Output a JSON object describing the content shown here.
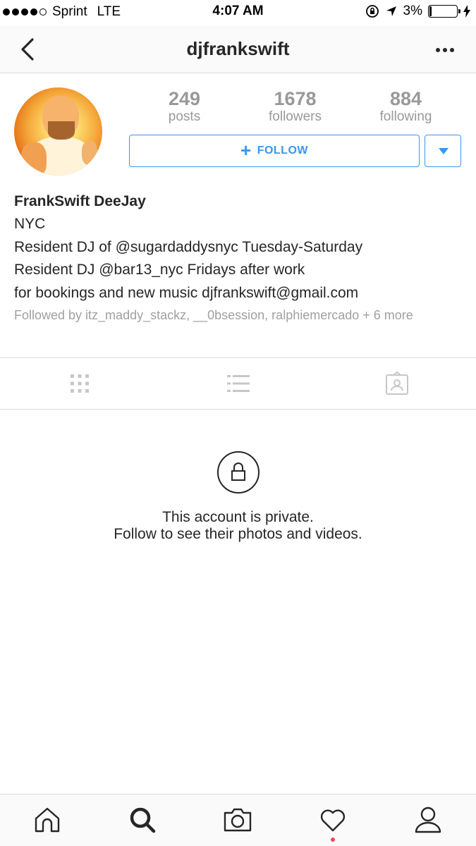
{
  "status_bar": {
    "carrier": "Sprint",
    "network": "LTE",
    "time": "4:07 AM",
    "battery": "3%",
    "signal_bars_filled": 4,
    "signal_bars_total": 5
  },
  "nav": {
    "title": "djfrankswift"
  },
  "stats": {
    "posts": {
      "value": "249",
      "label": "posts"
    },
    "followers": {
      "value": "1678",
      "label": "followers"
    },
    "following": {
      "value": "884",
      "label": "following"
    }
  },
  "actions": {
    "follow_label": "FOLLOW"
  },
  "bio": {
    "name": "FrankSwift DeeJay",
    "lines": [
      "NYC",
      "Resident DJ of @sugardaddysnyc Tuesday-Saturday",
      "Resident DJ @bar13_nyc Fridays after work",
      "for bookings and new music djfrankswift@gmail.com"
    ],
    "followed_by": "Followed by itz_maddy_stackz, __0bsession, ralphiemercado + 6 more"
  },
  "private": {
    "line1": "This account is private.",
    "line2": "Follow to see their photos and videos."
  },
  "colors": {
    "accent": "#3897f0",
    "text": "#262626",
    "muted": "#999999",
    "divider": "#dbdbdb",
    "notification": "#ed4956"
  },
  "icons": {
    "tabs": [
      "grid-icon",
      "list-icon",
      "tagged-icon"
    ],
    "bottom": [
      "home-icon",
      "search-icon",
      "camera-icon",
      "heart-icon",
      "profile-icon"
    ]
  }
}
